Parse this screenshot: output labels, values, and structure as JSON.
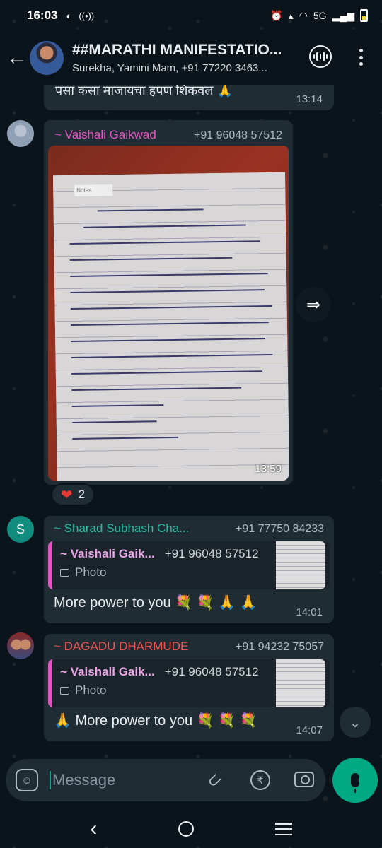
{
  "status_bar": {
    "time": "16:03",
    "network": "5G"
  },
  "header": {
    "title": "##MARATHI MANIFESTATIO...",
    "members": "Surekha, Yamini Mam, +91 77220 3463..."
  },
  "messages": {
    "top": {
      "text": "पसा कसा माजायचा हपण शिकवल",
      "emoji": "🙏",
      "time": "13:14"
    },
    "photo": {
      "sender": "~ Vaishali Gaikwad",
      "phone": "+91 96048 57512",
      "time": "13:59",
      "reaction_emoji": "❤",
      "reaction_count": "2"
    },
    "reply1": {
      "sender": "~ Sharad Subhash Cha...",
      "phone": "+91 77750 84233",
      "quoted_name": "~ Vaishali Gaik...",
      "quoted_phone": "+91 96048 57512",
      "quoted_type": "Photo",
      "text": "More power to you 💐 💐 🙏 🙏",
      "time": "14:01",
      "avatar_letter": "S"
    },
    "reply2": {
      "sender": "~ DAGADU DHARMUDE",
      "phone": "+91 94232 75057",
      "quoted_name": "~ Vaishali Gaik...",
      "quoted_phone": "+91 96048 57512",
      "quoted_type": "Photo",
      "text": "🙏 More power to you 💐 💐 💐",
      "time": "14:07"
    }
  },
  "input": {
    "placeholder": "Message"
  },
  "colors": {
    "accent": "#00a884",
    "sender_pink": "#e455c4",
    "sender_teal": "#25bfa4",
    "sender_red": "#ef5350"
  }
}
